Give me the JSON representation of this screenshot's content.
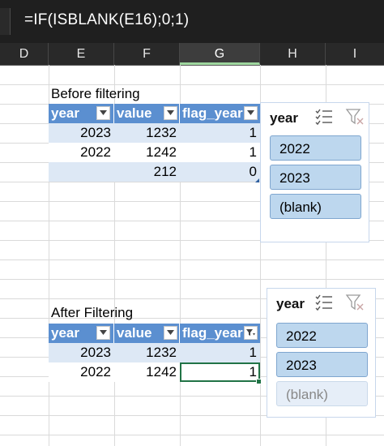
{
  "formula_bar": {
    "formula": "=IF(ISBLANK(E16);0;1)"
  },
  "columns": [
    "D",
    "E",
    "F",
    "G",
    "H",
    "I"
  ],
  "selected_column": "G",
  "section_before": {
    "label": "Before filtering",
    "headers": [
      "year",
      "value",
      "flag_year"
    ],
    "rows": [
      [
        "2023",
        "1232",
        "1"
      ],
      [
        "2022",
        "1242",
        "1"
      ],
      [
        "",
        "212",
        "0"
      ]
    ]
  },
  "section_after": {
    "label": "After Filtering",
    "headers": [
      "year",
      "value",
      "flag_year"
    ],
    "rows": [
      [
        "2023",
        "1232",
        "1"
      ],
      [
        "2022",
        "1242",
        "1"
      ]
    ]
  },
  "slicer_top": {
    "title": "year",
    "items": [
      {
        "label": "2022",
        "state": "selected"
      },
      {
        "label": "2023",
        "state": "selected"
      },
      {
        "label": "(blank)",
        "state": "selected"
      }
    ]
  },
  "slicer_bottom": {
    "title": "year",
    "items": [
      {
        "label": "2022",
        "state": "selected"
      },
      {
        "label": "2023",
        "state": "selected"
      },
      {
        "label": "(blank)",
        "state": "no-data"
      }
    ]
  },
  "icons": [
    "multi-select-icon",
    "clear-filter-icon",
    "filter-dropdown-icon",
    "filter-applied-icon"
  ],
  "colors": {
    "table_header": "#5b8fd0",
    "table_band": "#dde8f5",
    "slicer_selected": "#bdd7ee",
    "slicer_no_data": "#e6eef8",
    "active_cell": "#217346",
    "formula_bar_bg": "#1f1f1f"
  }
}
